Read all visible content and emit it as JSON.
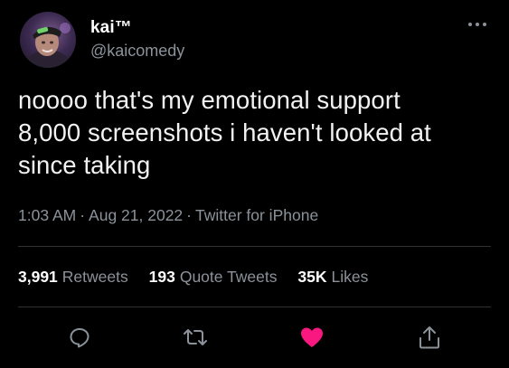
{
  "user": {
    "display_name": "kai™",
    "handle": "@kaicomedy"
  },
  "tweet": {
    "text": "noooo that's my emotional support\n8,000 screenshots i haven't looked at\nsince taking",
    "time": "1:03 AM",
    "date": "Aug 21, 2022",
    "source": "Twitter for iPhone"
  },
  "stats": {
    "retweets_count": "3,991",
    "retweets_label": "Retweets",
    "quote_count": "193",
    "quote_label": "Quote Tweets",
    "likes_count": "35K",
    "likes_label": "Likes"
  },
  "icons": {
    "more": "more-horizontal-icon",
    "reply": "reply-icon",
    "retweet": "retweet-icon",
    "like": "heart-icon",
    "share": "share-icon"
  },
  "colors": {
    "background": "#000000",
    "text": "#e7e9ea",
    "secondary": "#8b9299",
    "like": "#f91880",
    "divider": "#2f3336"
  }
}
